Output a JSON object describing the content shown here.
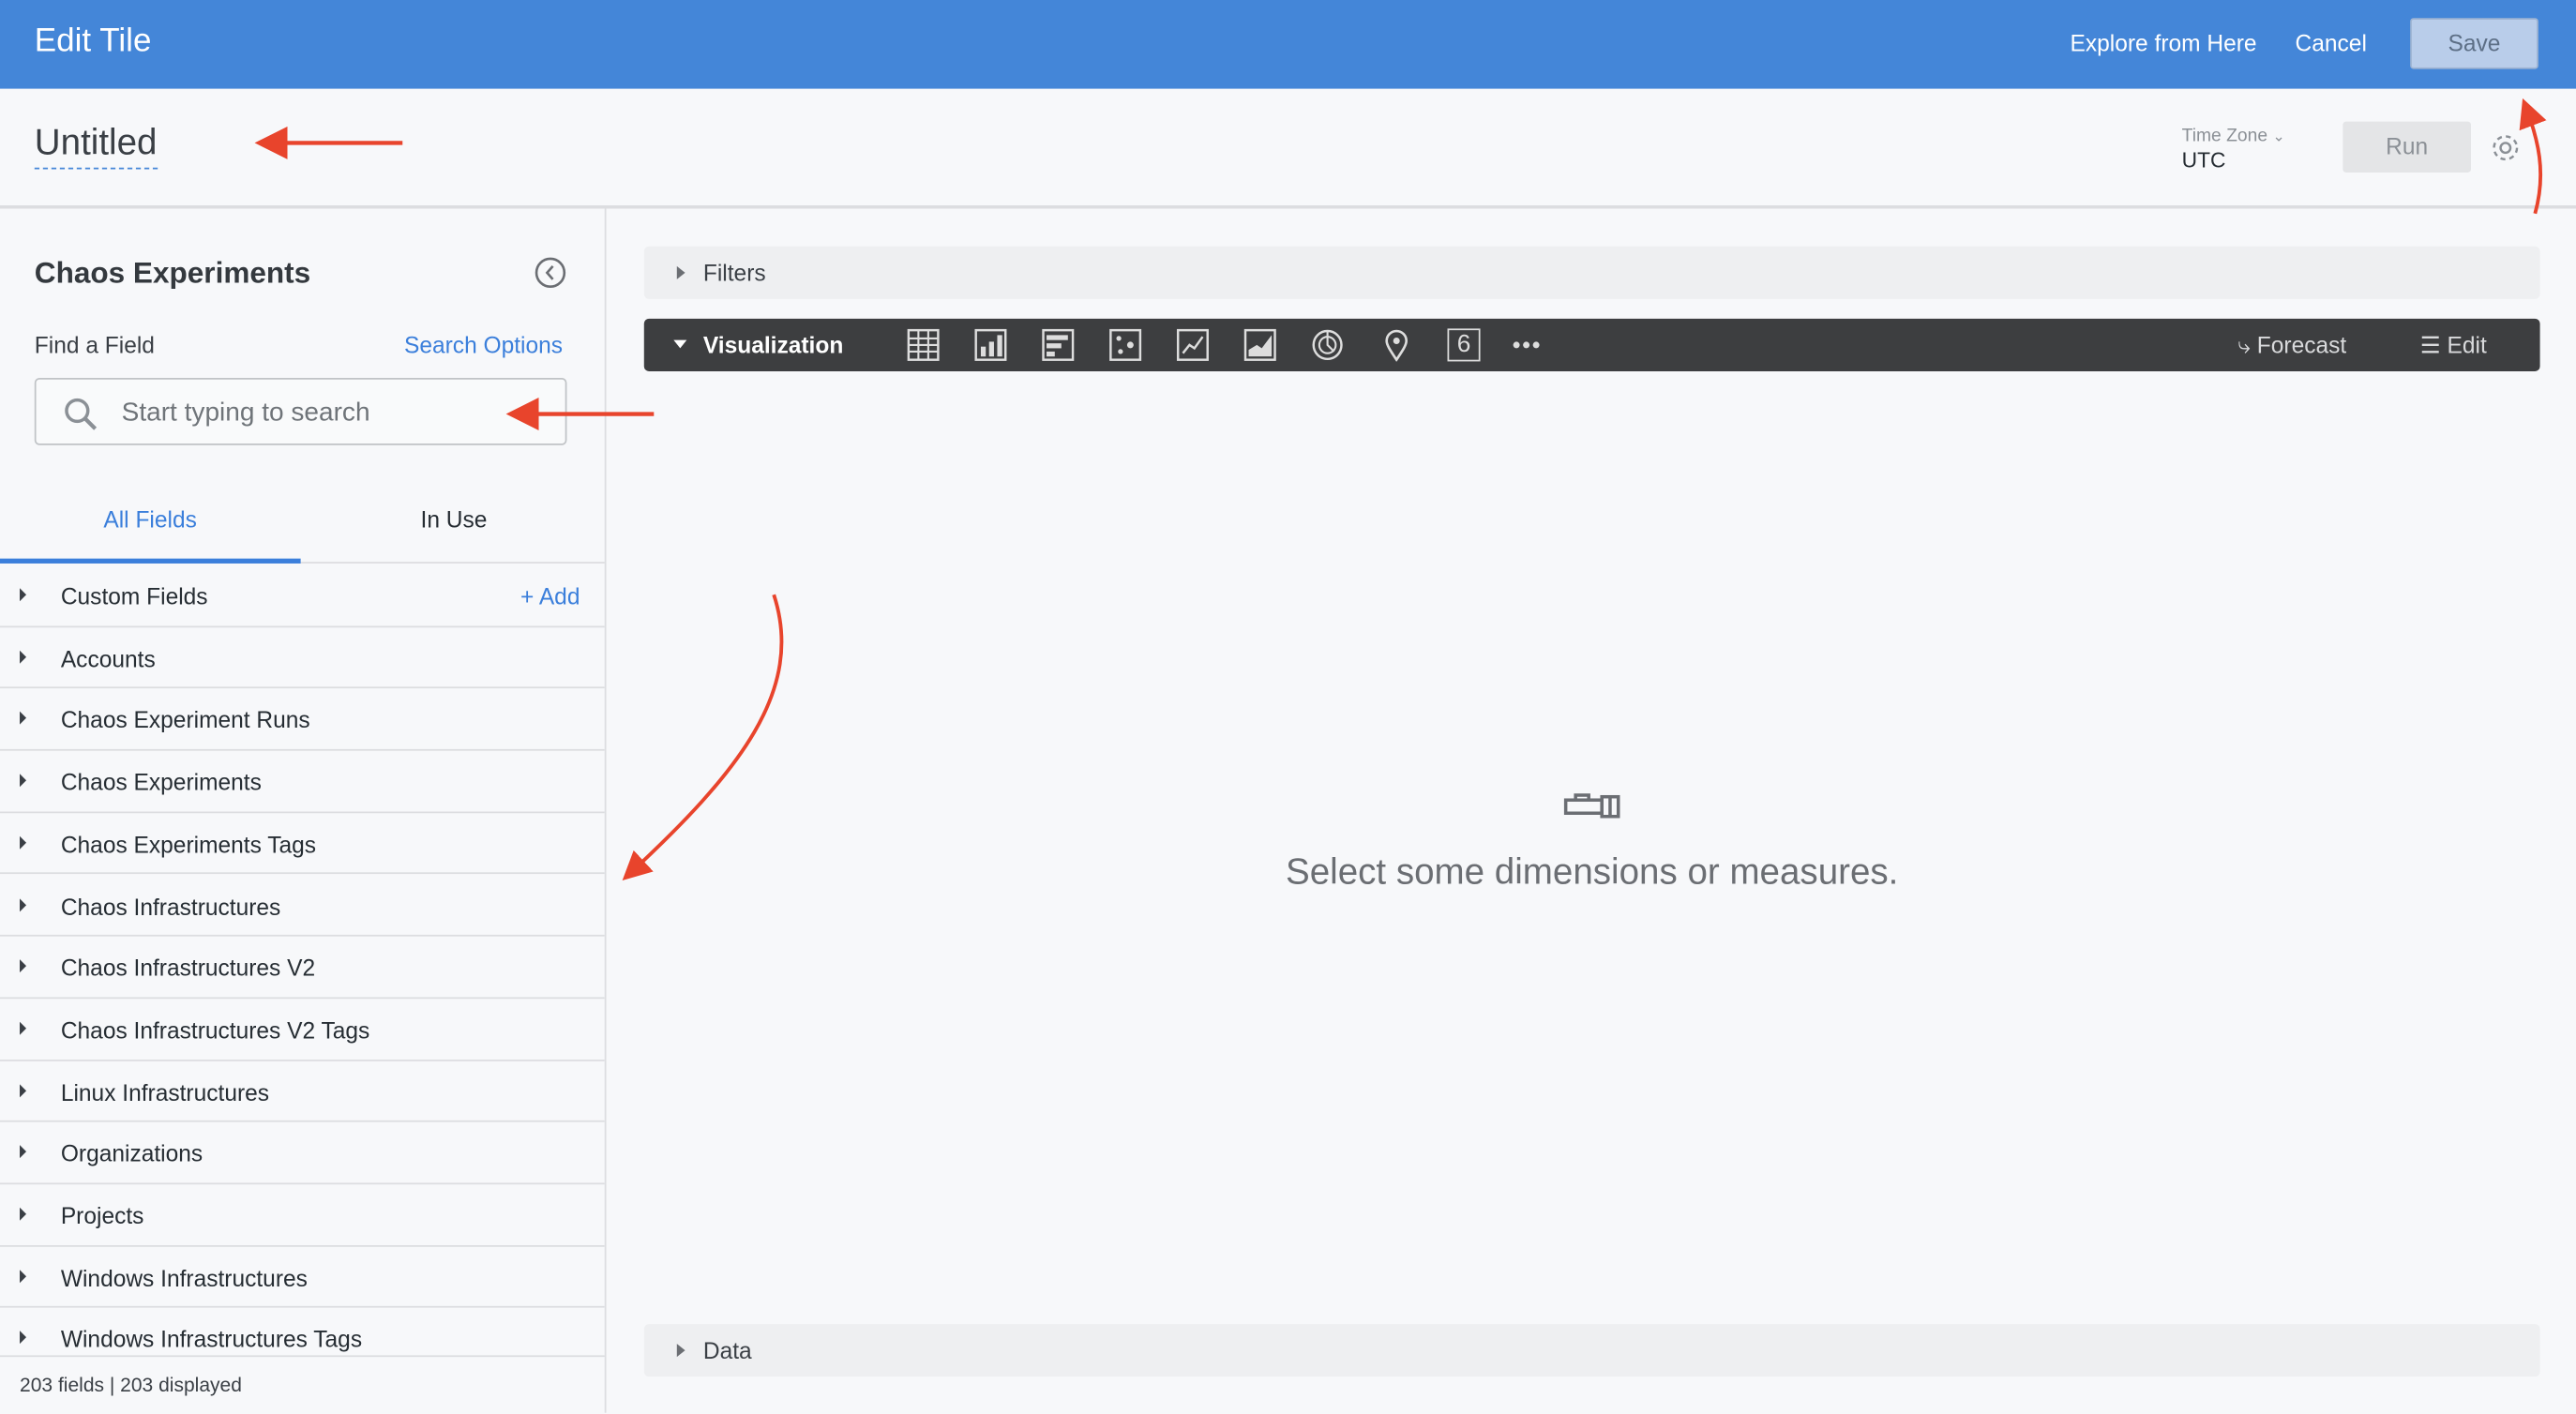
{
  "header": {
    "title": "Edit Tile",
    "explore_label": "Explore from Here",
    "cancel_label": "Cancel",
    "save_label": "Save"
  },
  "subheader": {
    "tile_title": "Untitled",
    "timezone_label": "Time Zone",
    "timezone_value": "UTC",
    "run_label": "Run"
  },
  "sidebar": {
    "title": "Chaos Experiments",
    "find_label": "Find a Field",
    "search_options_label": "Search Options",
    "search_placeholder": "Start typing to search",
    "tabs": [
      {
        "label": "All Fields",
        "active": true
      },
      {
        "label": "In Use",
        "active": false
      }
    ],
    "add_label": "+ Add",
    "items": [
      {
        "label": "Custom Fields"
      },
      {
        "label": "Accounts"
      },
      {
        "label": "Chaos Experiment Runs"
      },
      {
        "label": "Chaos Experiments"
      },
      {
        "label": "Chaos Experiments Tags"
      },
      {
        "label": "Chaos Infrastructures"
      },
      {
        "label": "Chaos Infrastructures V2"
      },
      {
        "label": "Chaos Infrastructures V2 Tags"
      },
      {
        "label": "Linux Infrastructures"
      },
      {
        "label": "Organizations"
      },
      {
        "label": "Projects"
      },
      {
        "label": "Windows Infrastructures"
      },
      {
        "label": "Windows Infrastructures Tags"
      }
    ],
    "footer": "203 fields | 203 displayed"
  },
  "main": {
    "filters_label": "Filters",
    "visualization_label": "Visualization",
    "viz_icons": [
      "table-icon",
      "column-chart-icon",
      "bar-chart-icon",
      "scatter-icon",
      "line-chart-icon",
      "area-chart-icon",
      "pie-chart-icon",
      "map-pin-icon",
      "single-value-icon",
      "more-icon"
    ],
    "single_value_glyph": "6",
    "forecast_label": "Forecast",
    "edit_label": "Edit",
    "empty_message": "Select some dimensions or measures.",
    "data_label": "Data"
  },
  "colors": {
    "header": "#4486d8",
    "accent": "#3b7fdb",
    "viz_bar": "#3d3e40",
    "annotation": "#e8442c"
  }
}
